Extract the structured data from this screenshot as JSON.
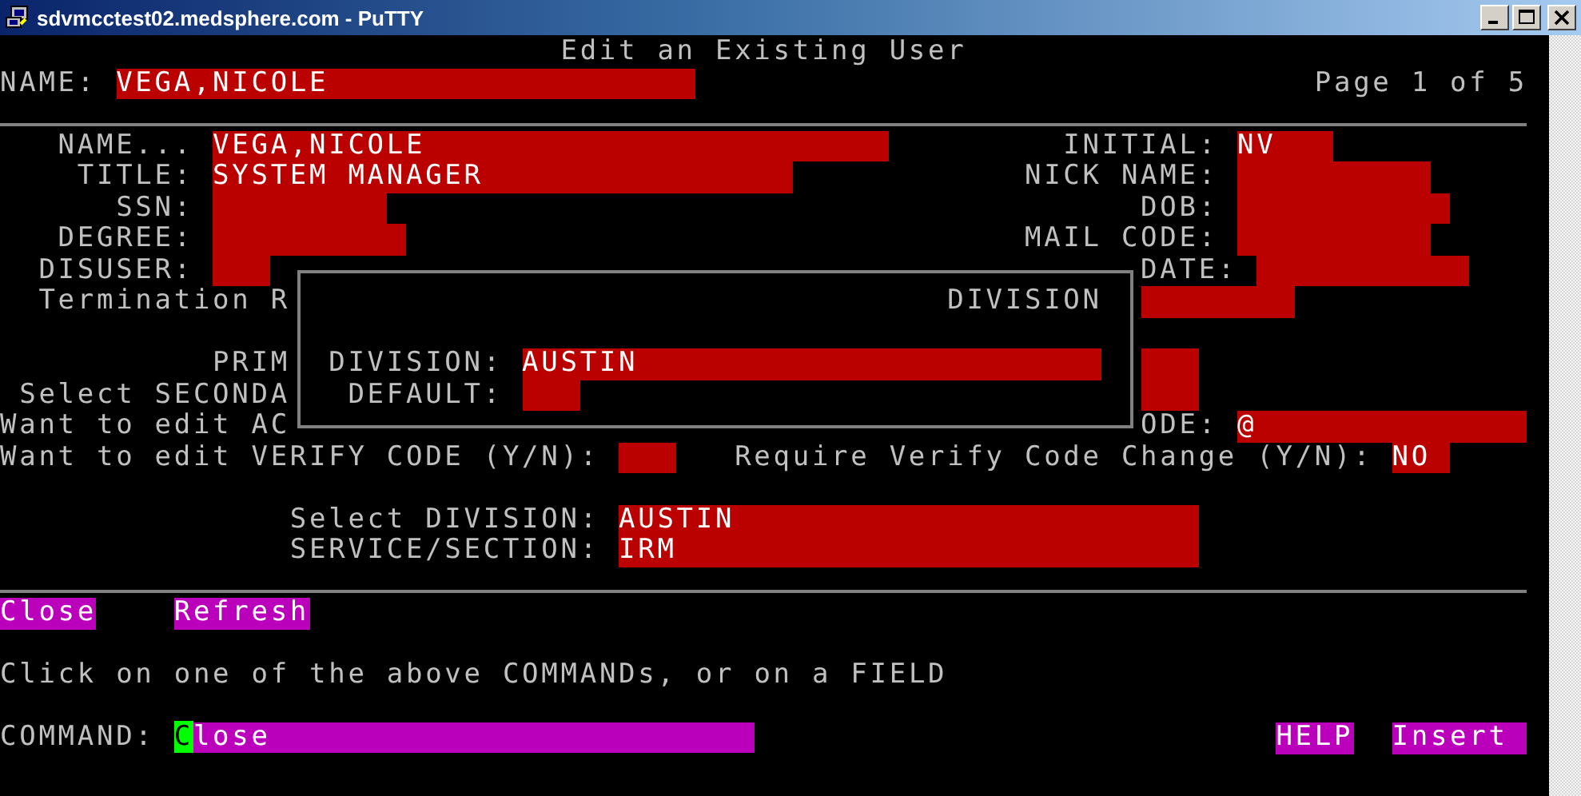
{
  "window": {
    "title": "sdvmcctest02.medsphere.com - PuTTY"
  },
  "screen_title": "Edit an Existing User",
  "header": {
    "label": "NAME:",
    "value": "VEGA,NICOLE",
    "page": "Page 1 of 5"
  },
  "form": [
    {
      "kind": "label",
      "text": "NAME..."
    },
    {
      "kind": "field",
      "value": "VEGA,NICOLE"
    },
    {
      "kind": "label",
      "text": "INITIAL:"
    },
    {
      "kind": "field",
      "value": "NV"
    },
    {
      "kind": "label",
      "text": "TITLE:"
    },
    {
      "kind": "field",
      "value": "SYSTEM MANAGER"
    },
    {
      "kind": "label",
      "text": "NICK NAME:"
    },
    {
      "kind": "field"
    },
    {
      "kind": "label",
      "text": "SSN:"
    },
    {
      "kind": "field"
    },
    {
      "kind": "label",
      "text": "DOB:"
    },
    {
      "kind": "field"
    },
    {
      "kind": "label",
      "text": "DEGREE:"
    },
    {
      "kind": "field"
    },
    {
      "kind": "label",
      "text": "MAIL CODE:"
    },
    {
      "kind": "field"
    },
    {
      "kind": "label",
      "text": "DISUSER:"
    },
    {
      "kind": "field"
    },
    {
      "kind": "label",
      "text": "DATE:"
    },
    {
      "kind": "field"
    },
    {
      "kind": "label",
      "text": "Termination R"
    },
    {
      "kind": "field"
    },
    {
      "kind": "label",
      "text": "PRIM"
    },
    {
      "kind": "field"
    },
    {
      "kind": "label",
      "text": "Select SECONDA"
    },
    {
      "kind": "field"
    },
    {
      "kind": "label",
      "text": "Want to edit AC"
    },
    {
      "kind": "label",
      "text": "ODE:"
    },
    {
      "kind": "field",
      "value": "@"
    },
    {
      "kind": "label",
      "text": "Want to edit VERIFY CODE (Y/N):"
    },
    {
      "kind": "field"
    },
    {
      "kind": "label",
      "text": "Require Verify Code Change (Y/N):"
    },
    {
      "kind": "field",
      "value": "NO"
    },
    {
      "kind": "label",
      "text": "Select DIVISION:"
    },
    {
      "kind": "field",
      "value": "AUSTIN"
    },
    {
      "kind": "label",
      "text": "SERVICE/SECTION:"
    },
    {
      "kind": "field",
      "value": "IRM"
    }
  ],
  "popup": {
    "title": "DIVISION",
    "items": [
      {
        "kind": "label",
        "text": "DIVISION:"
      },
      {
        "kind": "field",
        "value": "AUSTIN"
      },
      {
        "kind": "label",
        "text": "DEFAULT:"
      },
      {
        "kind": "field"
      }
    ]
  },
  "commands": [
    {
      "label": "Close"
    },
    {
      "label": "Refresh"
    }
  ],
  "hint": "Click on one of the above COMMANDs, or on a FIELD",
  "command_line": {
    "label": "COMMAND:",
    "value": "Close",
    "cursor": true
  },
  "status": [
    {
      "label": "HELP"
    },
    {
      "label": "Insert"
    }
  ]
}
